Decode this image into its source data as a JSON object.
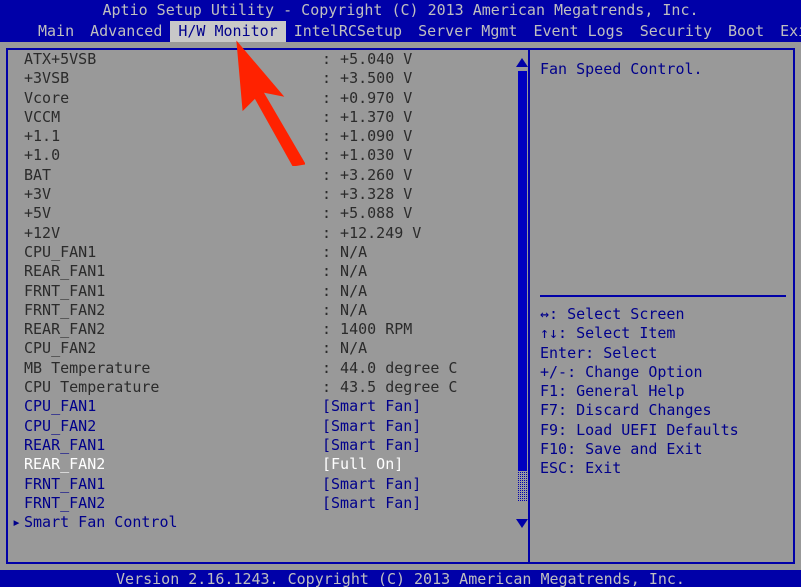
{
  "titlebar": {
    "title": "Aptio Setup Utility - Copyright (C) 2013 American Megatrends, Inc."
  },
  "menu": {
    "tabs": [
      {
        "label": "Main",
        "active": false
      },
      {
        "label": "Advanced",
        "active": false
      },
      {
        "label": "H/W Monitor",
        "active": true
      },
      {
        "label": "IntelRCSetup",
        "active": false
      },
      {
        "label": "Server Mgmt",
        "active": false
      },
      {
        "label": "Event Logs",
        "active": false
      },
      {
        "label": "Security",
        "active": false
      },
      {
        "label": "Boot",
        "active": false
      },
      {
        "label": "Exit",
        "active": false
      }
    ]
  },
  "main": {
    "rows": [
      {
        "label": "ATX+5VSB",
        "value": ": +5.040 V",
        "label_color": "dark",
        "value_color": "dark",
        "selected": false,
        "submenu": false
      },
      {
        "label": "+3VSB",
        "value": ": +3.500 V",
        "label_color": "dark",
        "value_color": "dark",
        "selected": false,
        "submenu": false
      },
      {
        "label": "Vcore",
        "value": ": +0.970 V",
        "label_color": "dark",
        "value_color": "dark",
        "selected": false,
        "submenu": false
      },
      {
        "label": "VCCM",
        "value": ": +1.370 V",
        "label_color": "dark",
        "value_color": "dark",
        "selected": false,
        "submenu": false
      },
      {
        "label": "+1.1",
        "value": ": +1.090 V",
        "label_color": "dark",
        "value_color": "dark",
        "selected": false,
        "submenu": false
      },
      {
        "label": "+1.0",
        "value": ": +1.030 V",
        "label_color": "dark",
        "value_color": "dark",
        "selected": false,
        "submenu": false
      },
      {
        "label": "BAT",
        "value": ": +3.260 V",
        "label_color": "dark",
        "value_color": "dark",
        "selected": false,
        "submenu": false
      },
      {
        "label": "+3V",
        "value": ": +3.328 V",
        "label_color": "dark",
        "value_color": "dark",
        "selected": false,
        "submenu": false
      },
      {
        "label": "+5V",
        "value": ": +5.088 V",
        "label_color": "dark",
        "value_color": "dark",
        "selected": false,
        "submenu": false
      },
      {
        "label": "+12V",
        "value": ": +12.249 V",
        "label_color": "dark",
        "value_color": "dark",
        "selected": false,
        "submenu": false
      },
      {
        "label": "CPU_FAN1",
        "value": ": N/A",
        "label_color": "dark",
        "value_color": "dark",
        "selected": false,
        "submenu": false
      },
      {
        "label": "REAR_FAN1",
        "value": ": N/A",
        "label_color": "dark",
        "value_color": "dark",
        "selected": false,
        "submenu": false
      },
      {
        "label": "FRNT_FAN1",
        "value": ": N/A",
        "label_color": "dark",
        "value_color": "dark",
        "selected": false,
        "submenu": false
      },
      {
        "label": "FRNT_FAN2",
        "value": ": N/A",
        "label_color": "dark",
        "value_color": "dark",
        "selected": false,
        "submenu": false
      },
      {
        "label": "REAR_FAN2",
        "value": ": 1400 RPM",
        "label_color": "dark",
        "value_color": "dark",
        "selected": false,
        "submenu": false
      },
      {
        "label": "CPU_FAN2",
        "value": ": N/A",
        "label_color": "dark",
        "value_color": "dark",
        "selected": false,
        "submenu": false
      },
      {
        "label": "MB Temperature",
        "value": ": 44.0 degree C",
        "label_color": "dark",
        "value_color": "dark",
        "selected": false,
        "submenu": false
      },
      {
        "label": "CPU Temperature",
        "value": ": 43.5 degree C",
        "label_color": "dark",
        "value_color": "dark",
        "selected": false,
        "submenu": false
      },
      {
        "label": "CPU_FAN1",
        "value": "[Smart Fan]",
        "label_color": "blue",
        "value_color": "blue",
        "selected": false,
        "submenu": false
      },
      {
        "label": "CPU_FAN2",
        "value": "[Smart Fan]",
        "label_color": "blue",
        "value_color": "blue",
        "selected": false,
        "submenu": false
      },
      {
        "label": "REAR_FAN1",
        "value": "[Smart Fan]",
        "label_color": "blue",
        "value_color": "blue",
        "selected": false,
        "submenu": false
      },
      {
        "label": "REAR_FAN2",
        "value": "[Full On]",
        "label_color": "white",
        "value_color": "white",
        "selected": true,
        "submenu": false
      },
      {
        "label": "FRNT_FAN1",
        "value": "[Smart Fan]",
        "label_color": "blue",
        "value_color": "blue",
        "selected": false,
        "submenu": false
      },
      {
        "label": "FRNT_FAN2",
        "value": "[Smart Fan]",
        "label_color": "blue",
        "value_color": "blue",
        "selected": false,
        "submenu": false
      },
      {
        "label": "Smart Fan Control",
        "value": "",
        "label_color": "blue",
        "value_color": "blue",
        "selected": false,
        "submenu": true
      }
    ],
    "scrollbar": {
      "up_arrow": "scroll-up-arrow",
      "down_arrow": "scroll-down-arrow"
    }
  },
  "help": {
    "description": "Fan Speed Control.",
    "keys": [
      "↔: Select Screen",
      "↑↓: Select Item",
      "Enter: Select",
      "+/-: Change Option",
      "F1: General Help",
      "F7: Discard Changes",
      "F9: Load UEFI Defaults",
      "F10: Save and Exit",
      "ESC: Exit"
    ]
  },
  "footer": {
    "version": "Version 2.16.1243. Copyright (C) 2013 American Megatrends, Inc."
  },
  "cursor": {
    "shape": "red-arrow-pointer"
  },
  "colors": {
    "background": "#999999",
    "bar_blue": "#0000a8",
    "text_blue": "#00008b",
    "text_dark": "#2b2b2b",
    "text_selected": "#ffffff",
    "tab_active_bg": "#c8c8c8",
    "cursor_red": "#ff2200"
  }
}
